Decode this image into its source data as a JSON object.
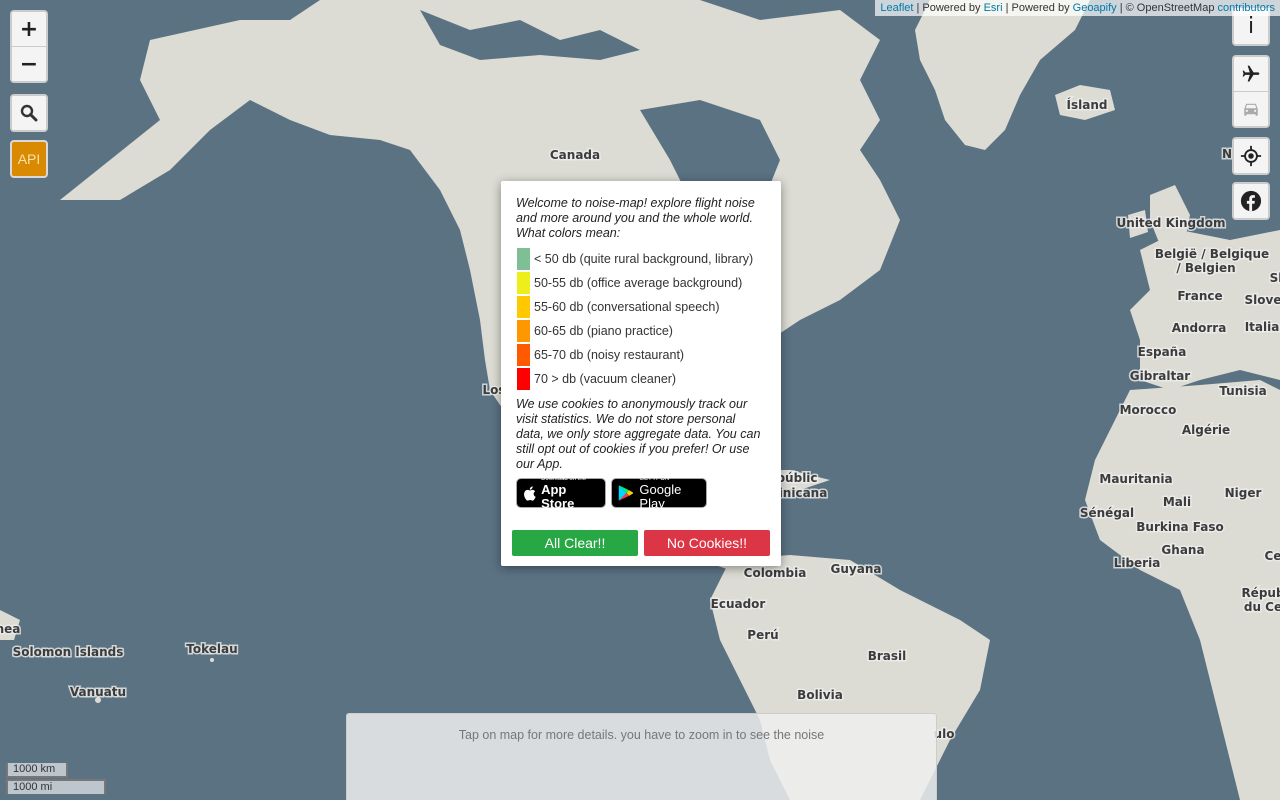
{
  "map": {
    "labels": [
      "Canada",
      "Ísland",
      "United Kingdom",
      "België / Belgique",
      "/ Belgien",
      "France",
      "Slove",
      "Andorra",
      "Italia",
      "España",
      "Gibraltar",
      "Morocco",
      "Algérie",
      "Tunisia",
      "Mauritania",
      "Mali",
      "Niger",
      "Sénégal",
      "Burkina Faso",
      "Ghana",
      "Liberia",
      "Répub",
      "du Ce",
      "Ce",
      "Colombia",
      "Guyana",
      "Ecuador",
      "Perú",
      "Brasil",
      "Bolivia",
      "Tokelau",
      "Solomon Islands",
      "Vanuatu",
      "nea",
      "Los",
      "públic",
      "inicana",
      "Sl",
      "N",
      "ulo"
    ]
  },
  "controls": {
    "zoom_in": "+",
    "zoom_out": "−",
    "search_icon": "search-icon",
    "api_label": "API",
    "info_label": "i",
    "flight_icon": "airplane-icon",
    "car_icon": "car-icon",
    "locate_icon": "crosshair-icon",
    "facebook_icon": "facebook-icon"
  },
  "attribution": {
    "leaflet": "Leaflet",
    "powered_esri_prefix": " | Powered by ",
    "esri": "Esri",
    "powered_geoapify_prefix": " | Powered by ",
    "geoapify": "Geoapify",
    "osm_prefix": " | © OpenStreetMap ",
    "contributors": "contributors"
  },
  "scale": {
    "km": "1000 km",
    "mi": "1000 mi"
  },
  "modal": {
    "intro": "Welcome to noise-map! explore flight noise and more around you and the whole world. What colors mean:",
    "legend": [
      {
        "color": "#7fbf95",
        "label": "< 50 db (quite rural background, library)"
      },
      {
        "color": "#eeee1c",
        "label": "50-55 db (office average background)"
      },
      {
        "color": "#ffc800",
        "label": "55-60 db (conversational speech)"
      },
      {
        "color": "#ff9800",
        "label": "60-65 db (piano practice)"
      },
      {
        "color": "#ff5a00",
        "label": "65-70 db (noisy restaurant)"
      },
      {
        "color": "#ff0000",
        "label": "70 > db (vacuum cleaner)"
      }
    ],
    "cookies": "We use cookies to anonymously track our visit statistics. We do not store personal data, we only store aggregate data. You can still opt out of cookies if you prefer! Or use our App.",
    "app_store_small": "Download on the",
    "app_store_big": "App Store",
    "google_small": "GET IT ON",
    "google_big": "Google Play",
    "accept": "All Clear!!",
    "decline": "No Cookies!!",
    "accept_color": "#28a745",
    "decline_color": "#dc3545"
  },
  "bottom_panel": {
    "text": "Tap on map for more details. you have to zoom in to see the noise"
  }
}
